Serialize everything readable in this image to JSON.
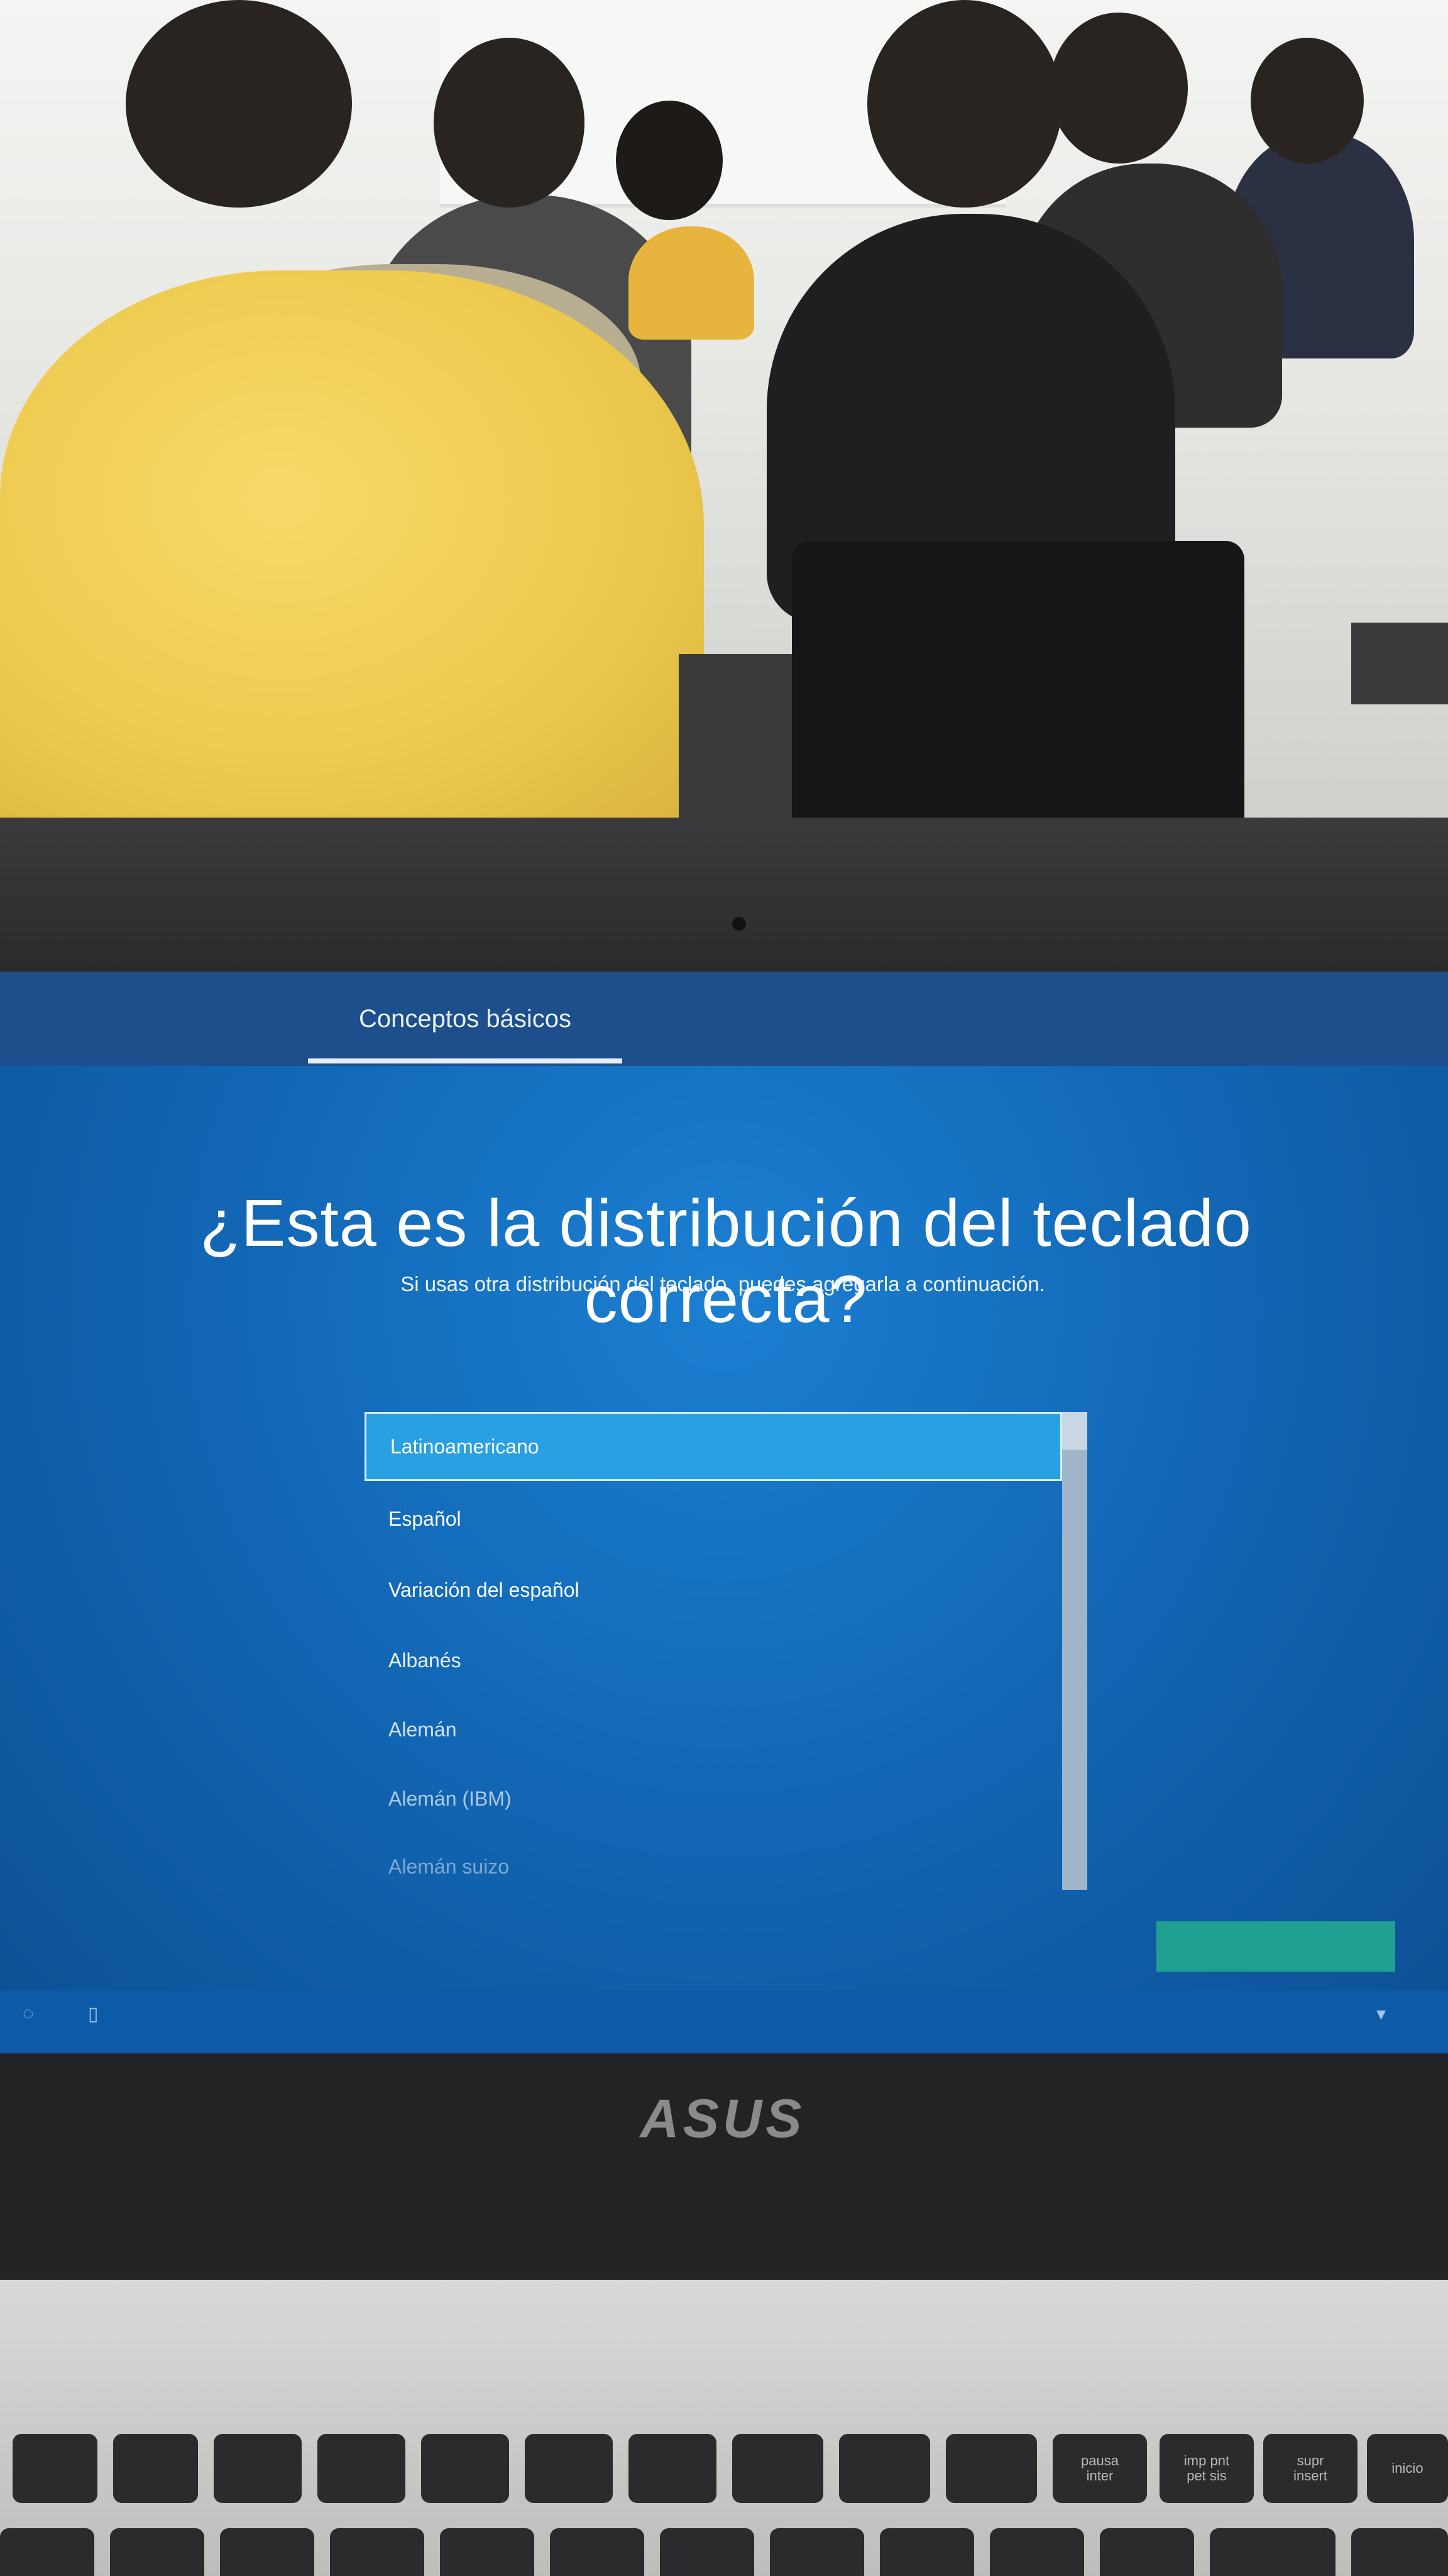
{
  "header": {
    "tab_label": "Conceptos básicos"
  },
  "main": {
    "title": "¿Esta es la distribución del teclado correcta?",
    "subtitle": "Si usas otra distribución del teclado, puedes agregarla a continuación."
  },
  "keyboard_list": {
    "items": [
      "Latinoamericano",
      "Español",
      "Variación del español",
      "Albanés",
      "Alemán",
      "Alemán (IBM)",
      "Alemán suizo"
    ],
    "selected": "Latinoamericano"
  },
  "laptop": {
    "brand": "ASUS"
  },
  "keys": {
    "pausa": "pausa\ninter",
    "imp": "imp pnt\npet sis",
    "supr": "supr\ninsert",
    "inicio": "inicio"
  },
  "colors": {
    "screen_blue": "#1268b6",
    "selected_item": "#29a0e2",
    "next_button": "#1fa090"
  }
}
